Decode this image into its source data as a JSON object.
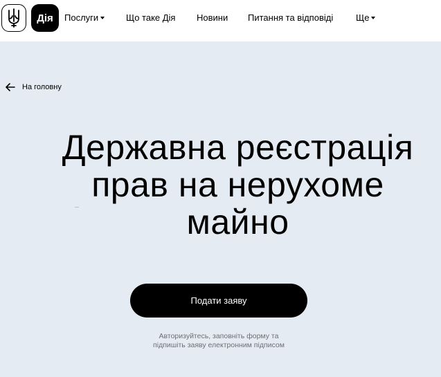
{
  "header": {
    "logo_text": "Дія",
    "nav": [
      {
        "label": "Послуги",
        "dropdown": true
      },
      {
        "label": "Що таке Дія",
        "dropdown": false
      },
      {
        "label": "Новини",
        "dropdown": false
      },
      {
        "label": "Питання та відповіді",
        "dropdown": false
      },
      {
        "label": "Ще",
        "dropdown": true
      }
    ]
  },
  "back_link": {
    "label": "На головну",
    "icon": "arrow-left-icon"
  },
  "hero": {
    "title_lines": [
      "Державна реєстрація",
      "прав на нерухоме",
      "майно"
    ],
    "cta_label": "Подати заяву",
    "hint_lines": [
      "Авторизуйтесь, заповніть форму та",
      "підпишіть заяву електронним підписом"
    ]
  },
  "colors": {
    "background": "#e4ebf2",
    "header": "#ffffff",
    "button": "#000000",
    "hint_text": "#6b6f75"
  }
}
